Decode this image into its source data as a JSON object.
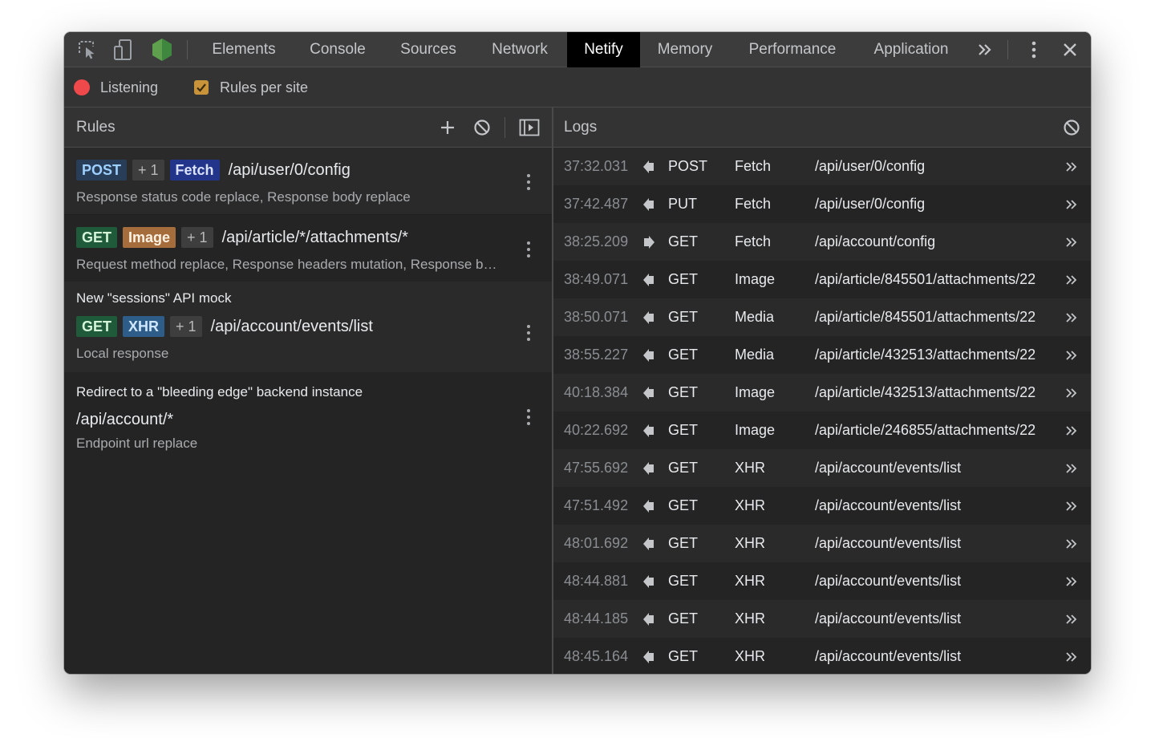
{
  "toolbar": {
    "icons": [
      "inspect-element-icon",
      "device-toolbar-icon",
      "node-icon"
    ],
    "tabs": [
      {
        "label": "Elements",
        "active": false
      },
      {
        "label": "Console",
        "active": false
      },
      {
        "label": "Sources",
        "active": false
      },
      {
        "label": "Network",
        "active": false
      },
      {
        "label": "Netify",
        "active": true
      },
      {
        "label": "Memory",
        "active": false
      },
      {
        "label": "Performance",
        "active": false
      },
      {
        "label": "Application",
        "active": false
      }
    ],
    "more_tabs_icon": "double-chevron-right-icon",
    "menu_icon": "vertical-dots-icon",
    "close_icon": "close-icon"
  },
  "status": {
    "listening_label": "Listening",
    "rules_per_site_label": "Rules per site",
    "rules_per_site_checked": true
  },
  "rules_panel": {
    "title": "Rules",
    "icons": [
      "plus-icon",
      "clear-icon",
      "toggle-sidebar-icon"
    ],
    "items": [
      {
        "name": "",
        "badges": [
          {
            "label": "POST",
            "kind": "post"
          },
          {
            "label": "+ 1",
            "kind": "plus"
          },
          {
            "label": "Fetch",
            "kind": "fetch"
          }
        ],
        "url": "/api/user/0/config",
        "description": "Response status code replace, Response body replace"
      },
      {
        "name": "",
        "badges": [
          {
            "label": "GET",
            "kind": "get"
          },
          {
            "label": "Image",
            "kind": "image"
          },
          {
            "label": "+ 1",
            "kind": "plus"
          }
        ],
        "url": "/api/article/*/attachments/*",
        "description": "Request method replace, Response headers mutation, Response body replace"
      },
      {
        "name": "New \"sessions\" API mock",
        "badges": [
          {
            "label": "GET",
            "kind": "get"
          },
          {
            "label": "XHR",
            "kind": "xhr"
          },
          {
            "label": "+ 1",
            "kind": "plus"
          }
        ],
        "url": "/api/account/events/list",
        "description": "Local response"
      },
      {
        "name": "Redirect to a \"bleeding edge\" backend instance",
        "badges": [],
        "url": "/api/account/*",
        "description": "Endpoint url replace"
      }
    ]
  },
  "logs_panel": {
    "title": "Logs",
    "clear_icon": "clear-icon",
    "rows": [
      {
        "time": "37:32.031",
        "direction": "request",
        "method": "POST",
        "type": "Fetch",
        "url": "/api/user/0/config"
      },
      {
        "time": "37:42.487",
        "direction": "request",
        "method": "PUT",
        "type": "Fetch",
        "url": "/api/user/0/config"
      },
      {
        "time": "38:25.209",
        "direction": "response",
        "method": "GET",
        "type": "Fetch",
        "url": "/api/account/config"
      },
      {
        "time": "38:49.071",
        "direction": "request",
        "method": "GET",
        "type": "Image",
        "url": "/api/article/845501/attachments/22"
      },
      {
        "time": "38:50.071",
        "direction": "request",
        "method": "GET",
        "type": "Media",
        "url": "/api/article/845501/attachments/22"
      },
      {
        "time": "38:55.227",
        "direction": "request",
        "method": "GET",
        "type": "Media",
        "url": "/api/article/432513/attachments/22"
      },
      {
        "time": "40:18.384",
        "direction": "request",
        "method": "GET",
        "type": "Image",
        "url": "/api/article/432513/attachments/22"
      },
      {
        "time": "40:22.692",
        "direction": "request",
        "method": "GET",
        "type": "Image",
        "url": "/api/article/246855/attachments/22"
      },
      {
        "time": "47:55.692",
        "direction": "request",
        "method": "GET",
        "type": "XHR",
        "url": "/api/account/events/list"
      },
      {
        "time": "47:51.492",
        "direction": "request",
        "method": "GET",
        "type": "XHR",
        "url": "/api/account/events/list"
      },
      {
        "time": "48:01.692",
        "direction": "request",
        "method": "GET",
        "type": "XHR",
        "url": "/api/account/events/list"
      },
      {
        "time": "48:44.881",
        "direction": "request",
        "method": "GET",
        "type": "XHR",
        "url": "/api/account/events/list"
      },
      {
        "time": "48:44.185",
        "direction": "request",
        "method": "GET",
        "type": "XHR",
        "url": "/api/account/events/list"
      },
      {
        "time": "48:45.164",
        "direction": "request",
        "method": "GET",
        "type": "XHR",
        "url": "/api/account/events/list"
      }
    ]
  },
  "colors": {
    "listening_dot": "#f0494b",
    "checkbox": "#c9933a",
    "active_tab_bg": "#000000",
    "panel_bg": "#242424"
  }
}
